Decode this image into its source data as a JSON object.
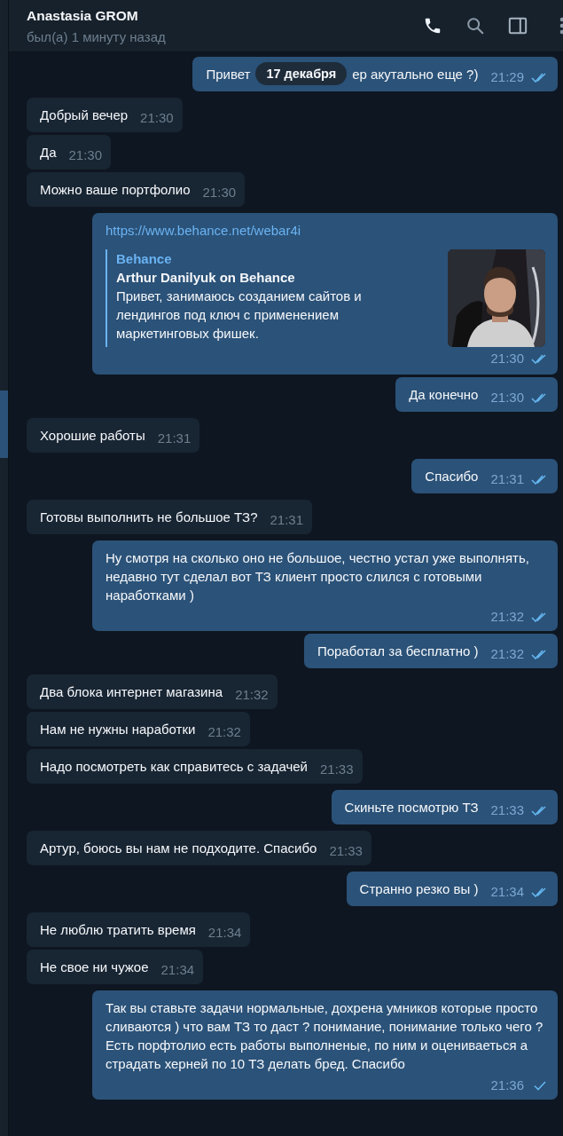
{
  "header": {
    "title": "Anastasia GROM",
    "status": "был(а) 1 минуту назад"
  },
  "date_badge": "17 декабря",
  "messages": [
    {
      "kind": "covered",
      "outgoing": true,
      "text_before": "Привет",
      "text_after": "ер акутально еще ?)",
      "time": "21:29",
      "read": true
    },
    {
      "kind": "text",
      "outgoing": false,
      "text": "Добрый вечер",
      "time": "21:30"
    },
    {
      "kind": "text",
      "outgoing": false,
      "text": "Да",
      "time": "21:30"
    },
    {
      "kind": "text",
      "outgoing": false,
      "text": "Можно ваше портфолио",
      "time": "21:30"
    },
    {
      "kind": "link",
      "outgoing": true,
      "url": "https://www.behance.net/webar4i",
      "preview": {
        "site": "Behance",
        "title": "Arthur Danilyuk on Behance",
        "description": "Привет, занимаюсь созданием сайтов и лендингов под ключ с применением маркетинговых фишек.",
        "kind": "picture"
      },
      "time": "21:30",
      "read": true
    },
    {
      "kind": "text",
      "outgoing": true,
      "text": "Да конечно",
      "time": "21:30",
      "read": true
    },
    {
      "kind": "text",
      "outgoing": false,
      "text": "Хорошие работы",
      "time": "21:31"
    },
    {
      "kind": "text",
      "outgoing": true,
      "text": "Спасибо",
      "time": "21:31",
      "read": true
    },
    {
      "kind": "text",
      "outgoing": false,
      "text": "Готовы выполнить не большое ТЗ?",
      "time": "21:31"
    },
    {
      "kind": "text",
      "outgoing": true,
      "text": "Ну смотря на сколько оно не большое, честно устал уже выполнять, недавно тут сделал вот ТЗ клиент просто слился с готовыми наработками )",
      "time": "21:32",
      "read": true
    },
    {
      "kind": "text",
      "outgoing": true,
      "text": "Поработал за бесплатно )",
      "time": "21:32",
      "read": true
    },
    {
      "kind": "text",
      "outgoing": false,
      "text": "Два блока интернет магазина",
      "time": "21:32"
    },
    {
      "kind": "text",
      "outgoing": false,
      "text": "Нам не нужны наработки",
      "time": "21:32"
    },
    {
      "kind": "text",
      "outgoing": false,
      "text": "Надо посмотреть как справитесь с задачей",
      "time": "21:33"
    },
    {
      "kind": "text",
      "outgoing": true,
      "text": "Скиньте посмотрю ТЗ",
      "time": "21:33",
      "read": true
    },
    {
      "kind": "text",
      "outgoing": false,
      "text": "Артур, боюсь вы нам не подходите. Спасибо",
      "time": "21:33"
    },
    {
      "kind": "text",
      "outgoing": true,
      "text": "Странно резко вы )",
      "time": "21:34",
      "read": true
    },
    {
      "kind": "text",
      "outgoing": false,
      "text": "Не люблю тратить время",
      "time": "21:34"
    },
    {
      "kind": "text",
      "outgoing": false,
      "text": "Не свое ни чужое",
      "time": "21:34"
    },
    {
      "kind": "text",
      "outgoing": true,
      "text": "Так вы ставьте задачи нормальные, дохрена умников которые просто сливаются ) что вам ТЗ то даст ? понимание, понимание только чего ? Есть порфтолио есть работы выполненые, по ним и оцениваеться а страдать херней по 10 ТЗ делать бред. Спасибо",
      "time": "21:36",
      "read": false
    }
  ]
}
